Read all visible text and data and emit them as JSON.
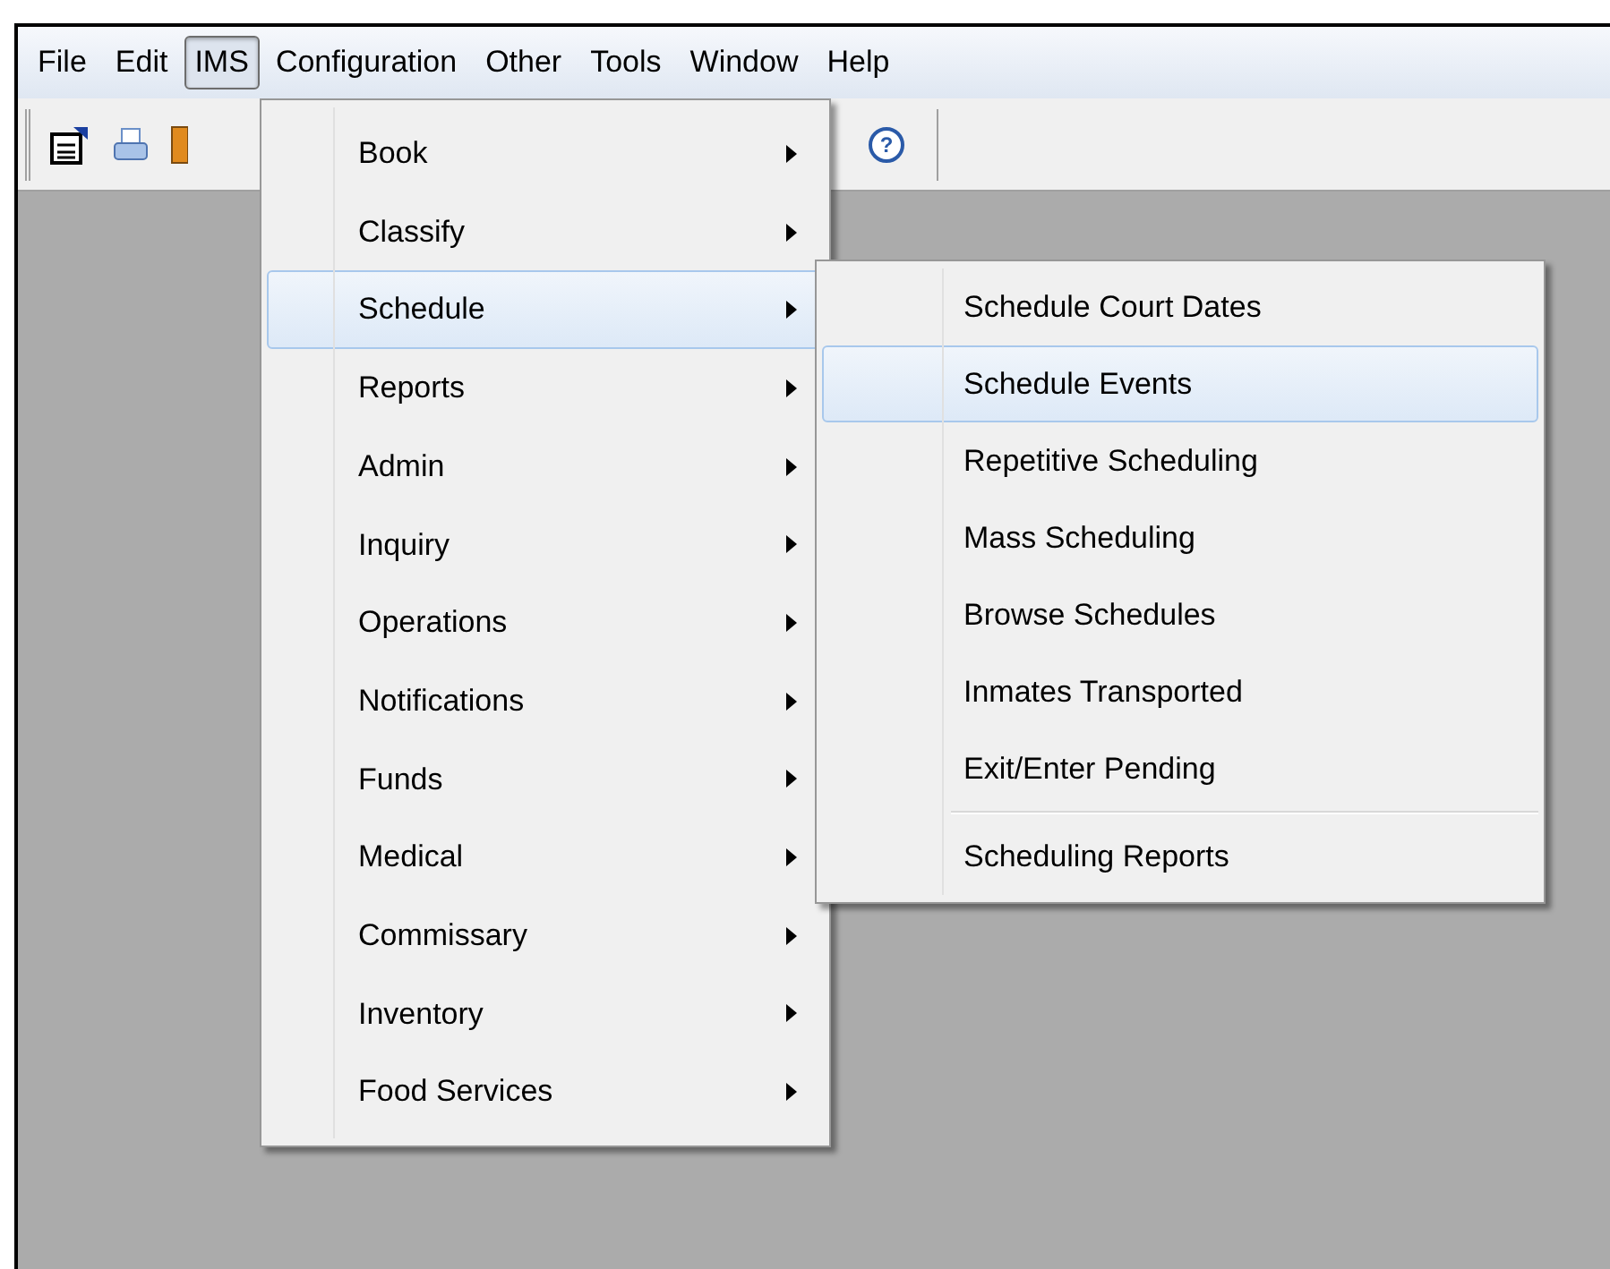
{
  "menu_bar": [
    {
      "label": "File",
      "selected": false
    },
    {
      "label": "Edit",
      "selected": false
    },
    {
      "label": "IMS",
      "selected": true
    },
    {
      "label": "Configuration",
      "selected": false
    },
    {
      "label": "Other",
      "selected": false
    },
    {
      "label": "Tools",
      "selected": false
    },
    {
      "label": "Window",
      "selected": false
    },
    {
      "label": "Help",
      "selected": false
    }
  ],
  "ims_menu": {
    "items": [
      {
        "label": "Book",
        "selected": false
      },
      {
        "label": "Classify",
        "selected": false
      },
      {
        "label": "Schedule",
        "selected": true
      },
      {
        "label": "Reports",
        "selected": false
      },
      {
        "label": "Admin",
        "selected": false
      },
      {
        "label": "Inquiry",
        "selected": false
      },
      {
        "label": "Operations",
        "selected": false
      },
      {
        "label": "Notifications",
        "selected": false
      },
      {
        "label": "Funds",
        "selected": false
      },
      {
        "label": "Medical",
        "selected": false
      },
      {
        "label": "Commissary",
        "selected": false
      },
      {
        "label": "Inventory",
        "selected": false
      },
      {
        "label": "Food Services",
        "selected": false
      }
    ]
  },
  "schedule_submenu": {
    "items": [
      {
        "label": "Schedule Court Dates",
        "selected": false,
        "kind": "item"
      },
      {
        "label": "Schedule Events",
        "selected": true,
        "kind": "item"
      },
      {
        "label": "Repetitive Scheduling",
        "selected": false,
        "kind": "item"
      },
      {
        "label": "Mass Scheduling",
        "selected": false,
        "kind": "item"
      },
      {
        "label": "Browse Schedules",
        "selected": false,
        "kind": "item"
      },
      {
        "label": "Inmates Transported",
        "selected": false,
        "kind": "item"
      },
      {
        "label": "Exit/Enter Pending",
        "selected": false,
        "kind": "item"
      },
      {
        "kind": "separator"
      },
      {
        "label": "Scheduling Reports",
        "selected": false,
        "kind": "item"
      }
    ]
  },
  "toolbar": {
    "help_button": "?"
  }
}
